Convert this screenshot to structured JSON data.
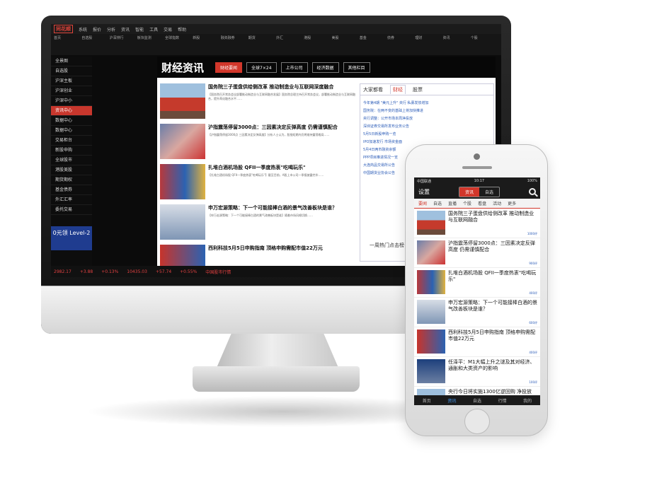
{
  "desktop": {
    "logo": "同花顺",
    "menu": [
      "系统",
      "报价",
      "分析",
      "资讯",
      "智能",
      "工具",
      "交易",
      "帮助"
    ],
    "quick": [
      "首页",
      "自选股",
      "沪深排行",
      "板块监测",
      "全球指数",
      "新股",
      "融资融券",
      "期货",
      "外汇",
      "港股",
      "美股",
      "基金",
      "债券",
      "理财",
      "资讯",
      "个股"
    ],
    "sidebar": [
      "全景图",
      "自选股",
      "沪深主板",
      "沪深创业",
      "沪深中小",
      "资讯中心",
      "数据中心",
      "数据中心",
      "交易柜台",
      "新股申购",
      "全球股市",
      "港股美股",
      "期货期权",
      "基金债券",
      "外汇汇率",
      "委托交易"
    ],
    "sidebar_active": 5,
    "level2": "0元领 Level-2",
    "content_title": "财经资讯",
    "tabs": [
      "财经要闻",
      "全球7×24",
      "上市公司",
      "经济数据",
      "其他栏目"
    ],
    "active_tab": 0,
    "news": [
      {
        "title": "国务院三子蛋盘供给侧改革 推动制造业与互联网深度融合",
        "summary": "【国务院召开常务会议部署推动制造业与互联网融合发展】国务院总理主持召开常务会议，部署推动制造业与互联网融合，提升两化融合水平……"
      },
      {
        "title": "沪指震荡停留3000点：三因素决定反弹高度 仍需谨慎配合",
        "summary": "【沪指震荡停留3000点 三因素决定反弹高度】分析人士认为，股指短期内仍将维持震荡格局……"
      },
      {
        "title": "扎堆白酒机场股 QFII一季度热衷\"吃喝玩乐\"",
        "summary": "【扎堆白酒机场股 QFII一季度热衷\"吃喝玩乐\"】截至目前，A股上市公司一季报披露完毕……"
      },
      {
        "title": "申万宏源策略：下一个可能接棒白酒的景气改善板块是谁？",
        "summary": "【申万宏源策略：下一个可能接棒白酒的景气改善板块是谁】随着市场风格切换……"
      },
      {
        "title": "西利科技5月5日申购指南 顶格申购需配市值22万元",
        "summary": ""
      }
    ],
    "right_tabs": [
      "大家都看",
      "财经",
      "股票"
    ],
    "right_active": 1,
    "right_list": [
      "今年第4期 \"美元上升\" 央行 私募发债增加",
      "国务院：在两不变的基础上将加快推进",
      "央行调整：公开市场本周净投放",
      "深圳证券交易所发布业务公告",
      "5月5日新股申购一览",
      "IPO加速发行 市场资金面",
      "5月4日两市融资余额",
      "PPP项目推进情况一览",
      "大连商品交易所公告",
      "中国期货业协会公告"
    ],
    "more": "一周热门点击榜",
    "ticker": [
      "2982.17",
      "+3.88",
      "+0.13%",
      "10435.03",
      "+57.74",
      "+0.55%",
      "中国股市行情"
    ]
  },
  "phone": {
    "status_left": "中国联通",
    "status_time": "10:17",
    "status_right": "100%",
    "header_left": "设置",
    "seg": [
      "资讯",
      "自选"
    ],
    "seg_active": 0,
    "nav": [
      "要闻",
      "自选",
      "直播",
      "个股",
      "看盘",
      "活动",
      "更多"
    ],
    "nav_active": 0,
    "items": [
      {
        "title": "国务院三子蛋盘供给侧改革 推动制造业与互联网融合",
        "count": "1000评"
      },
      {
        "title": "沪指震荡停留3000点：三因素决定反弹高度 仍需谨慎配合",
        "count": "900评"
      },
      {
        "title": "扎堆白酒机场股 QFII一季度热衷\"吃喝玩乐\"",
        "count": "400评"
      },
      {
        "title": "申万宏源策略：下一个可能接棒白酒的景气改善板块是谁？",
        "count": "600评"
      },
      {
        "title": "西利科技5月5日申购指南 顶格申购需配市值22万元",
        "count": "400评"
      },
      {
        "title": "任泽平：M1大幅上升之谜及其对经济、通胀和大类资产的影响",
        "count": "100评"
      },
      {
        "title": "央行今日将实施1300亿逆回购 净投放",
        "count": ""
      }
    ],
    "tabbar": [
      "首页",
      "资讯",
      "自选",
      "行情",
      "我的"
    ],
    "tab_active": 1
  }
}
